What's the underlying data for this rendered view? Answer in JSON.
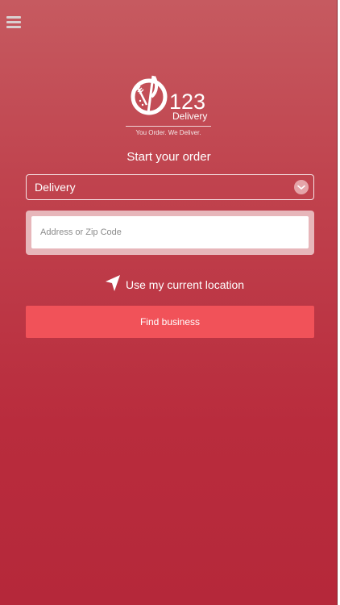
{
  "app": {
    "brand_number": "123",
    "brand_word": "Delivery",
    "tagline": "You Order. We Deliver."
  },
  "colors": {
    "background_top": "#c65a60",
    "background_bottom": "#b5283a",
    "button": "#f15259",
    "chevron_badge": "#e5a4a9"
  },
  "header": {
    "menu_icon": "hamburger-icon"
  },
  "order": {
    "title": "Start your order",
    "type_selected": "Delivery",
    "address_placeholder": "Address or Zip Code",
    "address_value": "",
    "location_label": "Use my current location",
    "location_icon": "navigation-arrow-icon",
    "submit_label": "Find business"
  }
}
